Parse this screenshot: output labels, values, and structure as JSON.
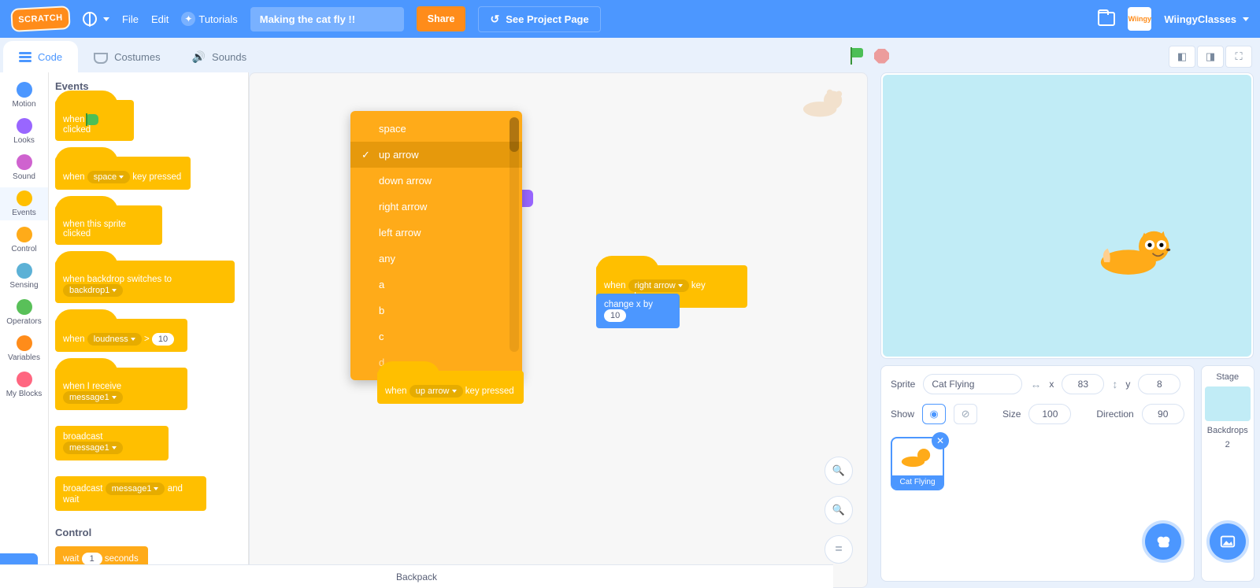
{
  "menu": {
    "logo_text": "SCRATCH",
    "file": "File",
    "edit": "Edit",
    "tutorials": "Tutorials",
    "project_title": "Making the cat fly !!",
    "share": "Share",
    "see_project": "See Project Page",
    "username": "WiingyClasses",
    "user_pic_text": "Wiingy"
  },
  "tabs": {
    "code": "Code",
    "costumes": "Costumes",
    "sounds": "Sounds"
  },
  "categories": [
    {
      "name": "Motion",
      "color": "#4c97ff"
    },
    {
      "name": "Looks",
      "color": "#9966ff"
    },
    {
      "name": "Sound",
      "color": "#cf63cf"
    },
    {
      "name": "Events",
      "color": "#ffbf00"
    },
    {
      "name": "Control",
      "color": "#ffab19"
    },
    {
      "name": "Sensing",
      "color": "#5cb1d6"
    },
    {
      "name": "Operators",
      "color": "#59c059"
    },
    {
      "name": "Variables",
      "color": "#ff8c1a"
    },
    {
      "name": "My Blocks",
      "color": "#ff6680"
    }
  ],
  "palette": {
    "headings": {
      "events": "Events",
      "control": "Control"
    },
    "when_flag": {
      "pre": "when",
      "post": "clicked"
    },
    "when_key": {
      "pre": "when",
      "key": "space",
      "post": "key pressed"
    },
    "when_clicked": "when this sprite clicked",
    "when_backdrop": {
      "pre": "when backdrop switches to",
      "opt": "backdrop1"
    },
    "when_loud": {
      "pre": "when",
      "opt": "loudness",
      "gt": ">",
      "val": "10"
    },
    "when_receive": {
      "pre": "when I receive",
      "opt": "message1"
    },
    "broadcast": {
      "pre": "broadcast",
      "opt": "message1"
    },
    "broadcast_wait": {
      "pre": "broadcast",
      "opt": "message1",
      "post": "and wait"
    },
    "wait": {
      "pre": "wait",
      "val": "1",
      "post": "seconds"
    }
  },
  "dropdown": {
    "options": [
      "space",
      "up arrow",
      "down arrow",
      "right arrow",
      "left arrow",
      "any",
      "a",
      "b",
      "c",
      "d"
    ],
    "selected_index": 1
  },
  "scripts": {
    "s1": {
      "pre": "when",
      "opt": "up arrow",
      "post": "key pressed"
    },
    "s2": {
      "pre": "when",
      "opt": "right arrow",
      "post": "key pressed"
    },
    "s3": {
      "pre": "change x by",
      "val": "10"
    }
  },
  "sprite_info": {
    "sprite_label": "Sprite",
    "name": "Cat Flying",
    "x_label": "x",
    "x": "83",
    "y_label": "y",
    "y": "8",
    "show_label": "Show",
    "size_label": "Size",
    "size": "100",
    "dir_label": "Direction",
    "dir": "90"
  },
  "sprite_tile": {
    "name": "Cat Flying"
  },
  "stage_sel": {
    "label": "Stage",
    "backdrops_label": "Backdrops",
    "count": "2"
  },
  "backpack": "Backpack",
  "zoom": {
    "in": "+",
    "out": "−",
    "eq": "="
  }
}
